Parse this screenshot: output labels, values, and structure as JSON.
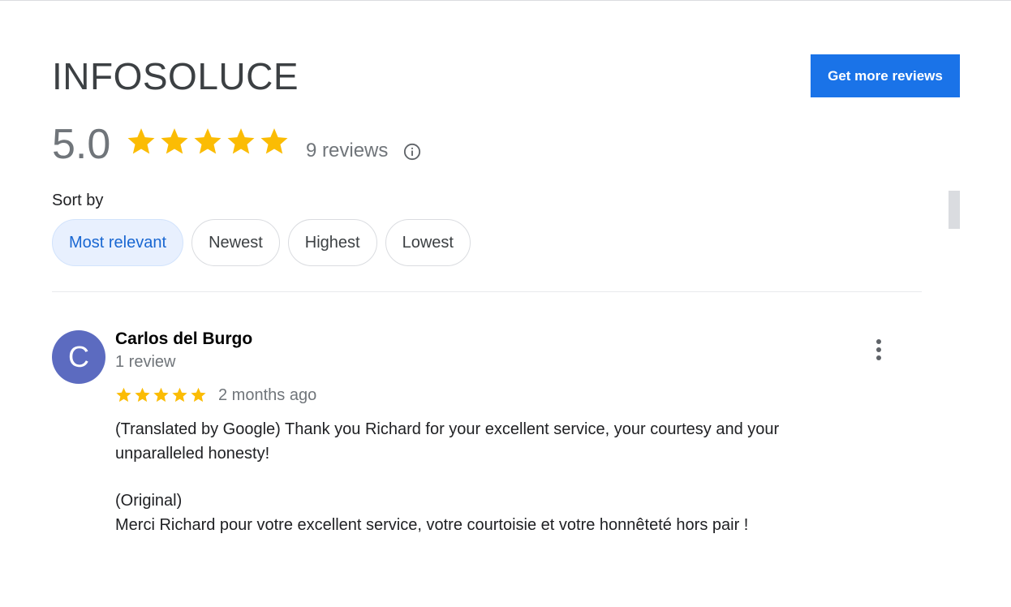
{
  "business": {
    "name": "INFOSOLUCE",
    "rating": "5.0",
    "stars": 5,
    "review_count_text": "9 reviews"
  },
  "actions": {
    "get_more_reviews": "Get more reviews"
  },
  "sort": {
    "label": "Sort by",
    "options": [
      "Most relevant",
      "Newest",
      "Highest",
      "Lowest"
    ],
    "selected": "Most relevant"
  },
  "review": {
    "avatar_letter": "C",
    "reviewer_name": "Carlos del Burgo",
    "reviewer_meta": "1 review",
    "stars": 5,
    "date": "2 months ago",
    "translated_text": "(Translated by Google) Thank you Richard for your excellent service, your courtesy and your unparalleled honesty!",
    "original_label": "(Original)",
    "original_text": "Merci Richard pour votre excellent service, votre courtoisie et votre honnêteté hors pair !"
  },
  "colors": {
    "accent": "#1a73e8",
    "star": "#fbbc04",
    "avatar": "#5c6bc0",
    "chip_active_bg": "#e8f0fe",
    "chip_active_text": "#1967d2"
  }
}
